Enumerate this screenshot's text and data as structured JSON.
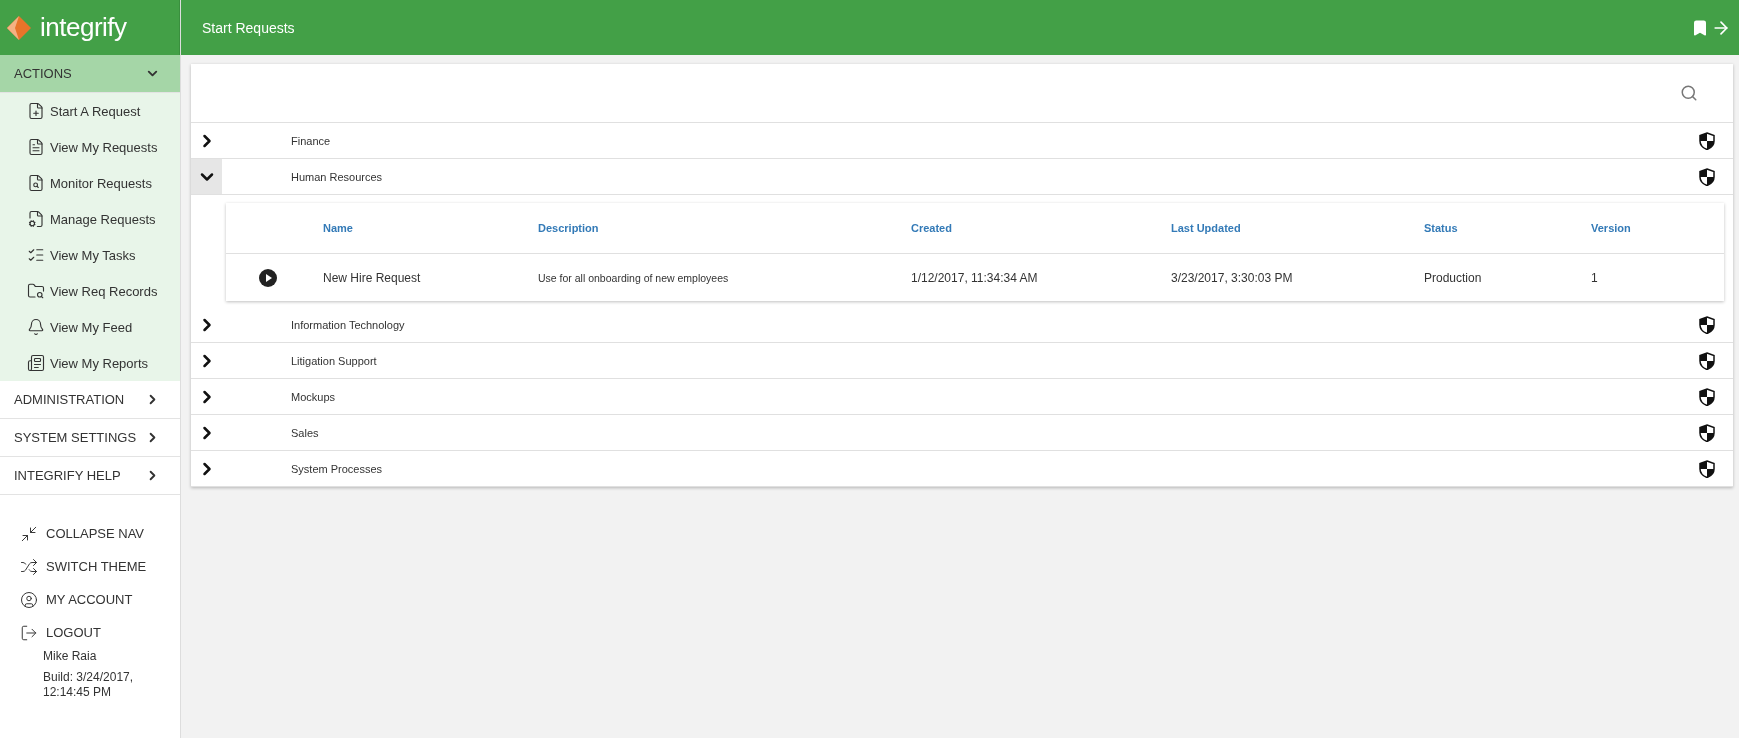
{
  "app": {
    "logo": "integrify",
    "page_title": "Start Requests"
  },
  "nav": {
    "sections": [
      {
        "label": "ACTIONS",
        "expanded": true,
        "items": [
          "Start A Request",
          "View My Requests",
          "Monitor Requests",
          "Manage Requests",
          "View My Tasks",
          "View Req Records",
          "View My Feed",
          "View My Reports"
        ]
      },
      {
        "label": "ADMINISTRATION",
        "expanded": false
      },
      {
        "label": "SYSTEM SETTINGS",
        "expanded": false
      },
      {
        "label": "INTEGRIFY HELP",
        "expanded": false
      }
    ],
    "actions": [
      "COLLAPSE NAV",
      "SWITCH THEME",
      "MY ACCOUNT",
      "LOGOUT"
    ],
    "user": {
      "name": "Mike Raia",
      "build": "Build: 3/24/2017, 12:14:45 PM"
    }
  },
  "categories": [
    {
      "name": "Finance",
      "expanded": false
    },
    {
      "name": "Human Resources",
      "expanded": true,
      "processes": {
        "columns": [
          "Name",
          "Description",
          "Created",
          "Last Updated",
          "Status",
          "Version"
        ],
        "rows": [
          {
            "cells": [
              "New Hire Request",
              "Use for all onboarding of new employees",
              "1/12/2017, 11:34:34 AM",
              "3/23/2017, 3:30:03 PM",
              "Production",
              "1"
            ]
          }
        ]
      }
    },
    {
      "name": "Information Technology",
      "expanded": false
    },
    {
      "name": "Litigation Support",
      "expanded": false
    },
    {
      "name": "Mockups",
      "expanded": false
    },
    {
      "name": "Sales",
      "expanded": false
    },
    {
      "name": "System Processes",
      "expanded": false
    }
  ]
}
